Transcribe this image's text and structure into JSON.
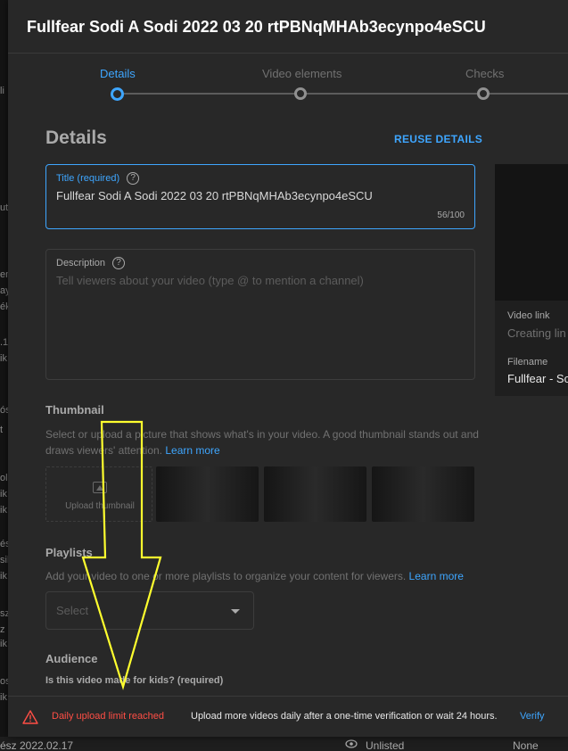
{
  "dialog": {
    "title": "Fullfear Sodi A Sodi 2022 03 20 rtPBNqMHAb3ecynpo4eSCU"
  },
  "stepper": {
    "steps": [
      {
        "label": "Details",
        "active": true
      },
      {
        "label": "Video elements",
        "active": false
      },
      {
        "label": "Checks",
        "active": false
      }
    ]
  },
  "details": {
    "heading": "Details",
    "reuse_label": "REUSE DETAILS",
    "title_field": {
      "label": "Title (required)",
      "value": "Fullfear   Sodi A Sodi 2022 03 20 rtPBNqMHAb3ecynpo4eSCU",
      "counter": "56/100"
    },
    "description_field": {
      "label": "Description",
      "placeholder": "Tell viewers about your video (type @ to mention a channel)"
    }
  },
  "thumbnail": {
    "heading": "Thumbnail",
    "description": "Select or upload a picture that shows what's in your video. A good thumbnail stands out and draws viewers' attention.",
    "learn_more": "Learn more",
    "upload_label": "Upload thumbnail"
  },
  "playlists": {
    "heading": "Playlists",
    "description": "Add your video to one or more playlists to organize your content for viewers.",
    "learn_more": "Learn more",
    "select_value": "Select"
  },
  "audience": {
    "heading": "Audience",
    "question": "Is this video made for kids? (required)"
  },
  "preview": {
    "video_link_label": "Video link",
    "video_link_value": "Creating lin",
    "filename_label": "Filename",
    "filename_value": "Fullfear - So"
  },
  "footer": {
    "warning": "Daily upload limit reached",
    "info": "Upload more videos daily after a one-time verification or wait 24 hours.",
    "verify_label": "Verify",
    "warning_color": "#ff4e45",
    "accent_color": "#3ea6ff"
  },
  "background": {
    "row_date": "ész 2022.02.17",
    "row_visibility": "Unlisted",
    "row_restrictions": "None",
    "side_fragments": [
      "li",
      "ut",
      "en",
      "ay",
      "ék",
      ".1",
      "ik",
      "ós",
      "t",
      "ol",
      "ik",
      "ik",
      "és",
      "sik",
      "ik",
      "sz",
      "z",
      "ik",
      "os,",
      "ik"
    ]
  },
  "annotation": {
    "arrow_color": "#ffff2e",
    "icons": [
      "warning-triangle-icon",
      "help-circle-icon",
      "image-upload-icon",
      "chevron-down-icon",
      "eye-icon"
    ]
  }
}
